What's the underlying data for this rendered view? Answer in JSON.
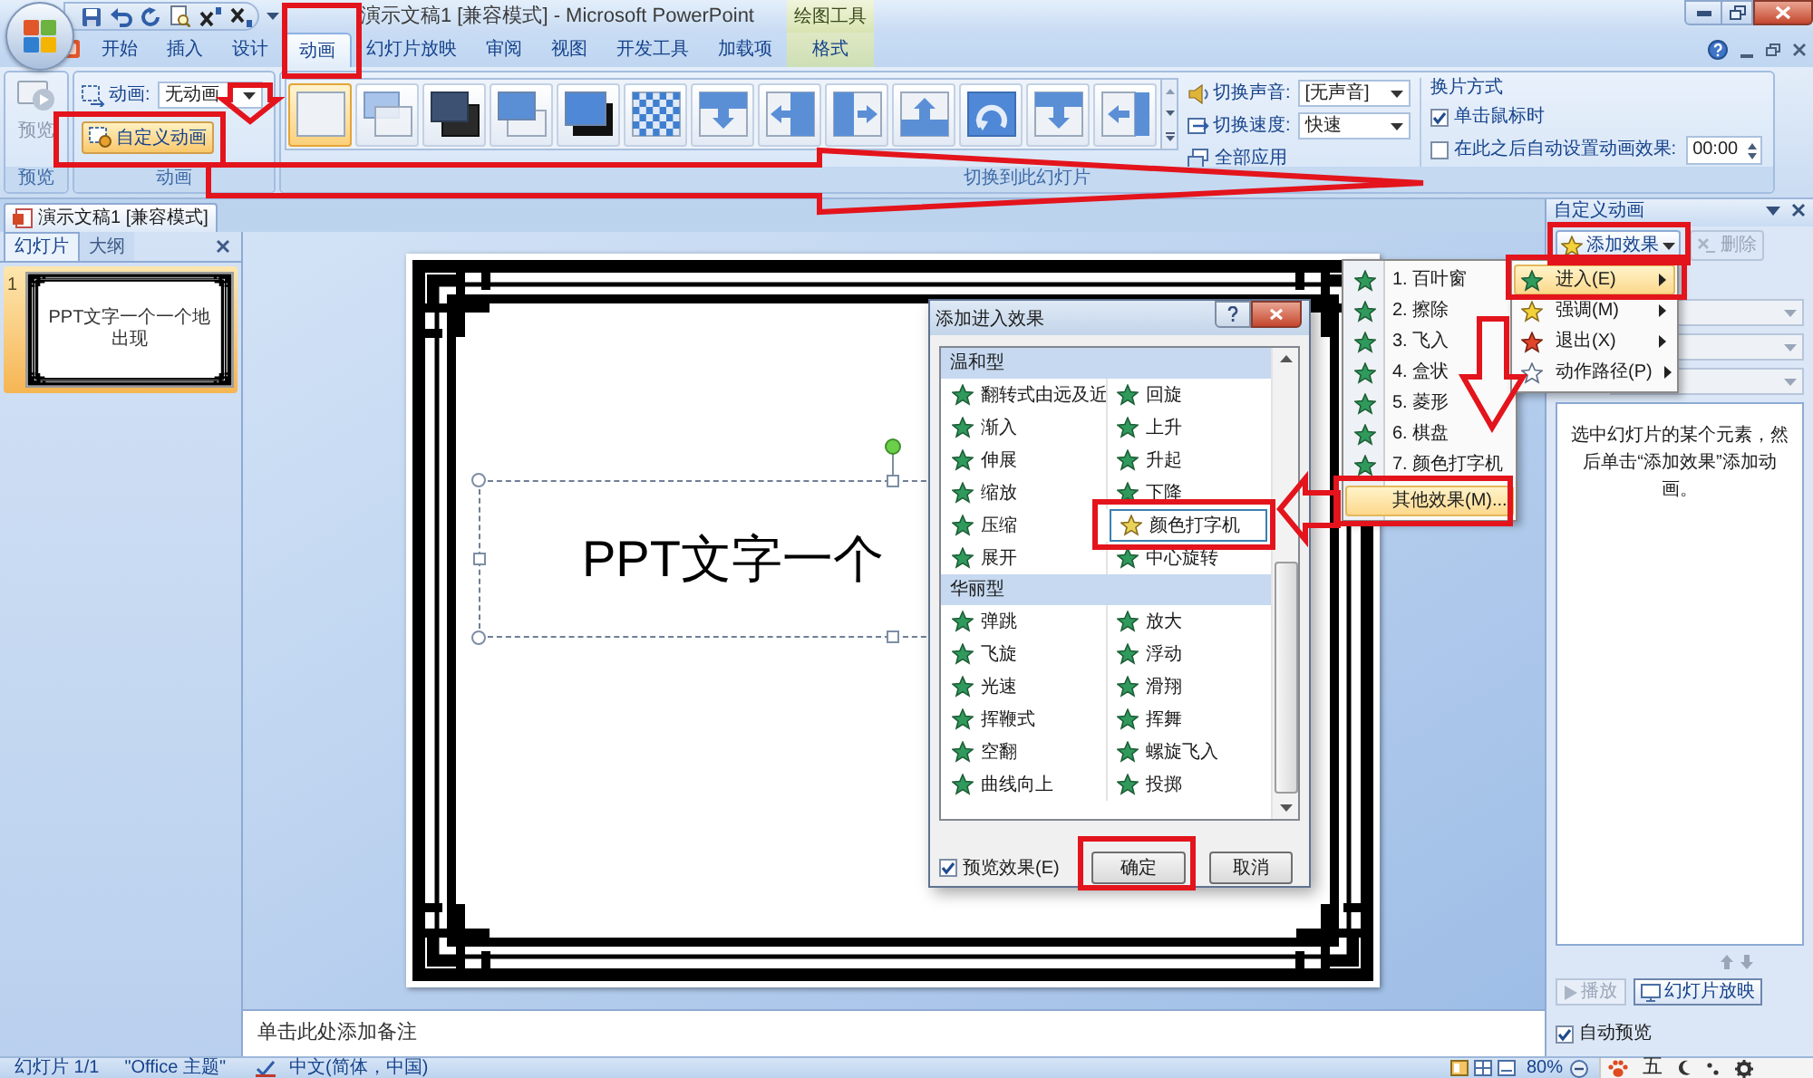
{
  "window": {
    "title": "演示文稿1 [兼容模式] - Microsoft PowerPoint",
    "context_tab_group": "绘图工具"
  },
  "ribbon_tabs": [
    {
      "label": "开始",
      "kind": "main",
      "selected": false
    },
    {
      "label": "插入",
      "kind": "main",
      "selected": false
    },
    {
      "label": "设计",
      "kind": "main",
      "selected": false
    },
    {
      "label": "动画",
      "kind": "main",
      "selected": true
    },
    {
      "label": "幻灯片放映",
      "kind": "main",
      "selected": false
    },
    {
      "label": "审阅",
      "kind": "main",
      "selected": false
    },
    {
      "label": "视图",
      "kind": "main",
      "selected": false
    },
    {
      "label": "开发工具",
      "kind": "main",
      "selected": false
    },
    {
      "label": "加载项",
      "kind": "main",
      "selected": false
    },
    {
      "label": "格式",
      "kind": "context",
      "selected": false
    }
  ],
  "ribbon": {
    "preview": {
      "button": {
        "label": "预览",
        "disabled": true
      },
      "group_label": "预览"
    },
    "animation": {
      "label": "动画:",
      "value": "无动画",
      "custom_button": {
        "label": "自定义动画",
        "selected": true
      },
      "group_label": "动画"
    },
    "transition": {
      "gallery": [
        {
          "selected": true
        },
        {
          "selected": false
        },
        {
          "selected": false
        },
        {
          "selected": false
        },
        {
          "selected": false
        },
        {
          "selected": false
        },
        {
          "selected": false
        },
        {
          "selected": false
        },
        {
          "selected": false
        },
        {
          "selected": false
        },
        {
          "selected": false
        },
        {
          "selected": false
        },
        {
          "selected": false
        }
      ],
      "sound": {
        "label": "切换声音:",
        "value": "[无声音]"
      },
      "speed": {
        "label": "切换速度:",
        "value": "快速"
      },
      "apply_all": "全部应用",
      "advance_title": "换片方式",
      "advance_options": [
        {
          "label": "单击鼠标时",
          "checked": true
        },
        {
          "label": "在此之后自动设置动画效果:",
          "checked": false,
          "value": "00:00"
        }
      ],
      "group_label": "切换到此幻灯片"
    }
  },
  "document_tab": {
    "label": "演示文稿1 [兼容模式]"
  },
  "slides_panel": {
    "tabs": [
      {
        "label": "幻灯片",
        "selected": true
      },
      {
        "label": "大纲",
        "selected": false
      }
    ],
    "slides": [
      {
        "number": "1",
        "text": "PPT文字一个一个地出现",
        "selected": true
      }
    ]
  },
  "slide": {
    "text": "PPT文字一个"
  },
  "notes": {
    "placeholder": "单击此处添加备注"
  },
  "task_pane": {
    "title": "自定义动画",
    "add_button": "添加效果",
    "remove_button": {
      "label": "删除",
      "disabled": true
    },
    "hint": "选中幻灯片的某个元素，然后单击“添加效果”添加动画。",
    "play_button": {
      "label": "播放",
      "disabled": true
    },
    "slideshow_button": "幻灯片放映",
    "auto_preview": {
      "label": "自动预览",
      "checked": true
    }
  },
  "add_effect_menu": [
    {
      "label": "进入(E)",
      "kind": "entrance",
      "selected": true
    },
    {
      "label": "强调(M)",
      "kind": "emphasis",
      "selected": false
    },
    {
      "label": "退出(X)",
      "kind": "exit",
      "selected": false
    },
    {
      "label": "动作路径(P)",
      "kind": "path",
      "selected": false
    }
  ],
  "entrance_menu": [
    {
      "label": "1. 百叶窗",
      "kind": "effect",
      "selected": false
    },
    {
      "label": "2. 擦除",
      "kind": "effect",
      "selected": false
    },
    {
      "label": "3. 飞入",
      "kind": "effect",
      "selected": false
    },
    {
      "label": "4. 盒状",
      "kind": "effect",
      "selected": false
    },
    {
      "label": "5. 菱形",
      "kind": "effect",
      "selected": false
    },
    {
      "label": "6. 棋盘",
      "kind": "effect",
      "selected": false
    },
    {
      "label": "7. 颜色打字机",
      "kind": "effect",
      "selected": false
    },
    {
      "label": "其他效果(M)...",
      "kind": "more",
      "selected": true
    }
  ],
  "dialog": {
    "title": "添加进入效果",
    "categories": [
      {
        "name": "温和型",
        "effects": [
          {
            "label": "翻转式由远及近",
            "selected": false
          },
          {
            "label": "回旋",
            "selected": false
          },
          {
            "label": "渐入",
            "selected": false
          },
          {
            "label": "上升",
            "selected": false
          },
          {
            "label": "伸展",
            "selected": false
          },
          {
            "label": "升起",
            "selected": false
          },
          {
            "label": "缩放",
            "selected": false
          },
          {
            "label": "下降",
            "selected": false
          },
          {
            "label": "压缩",
            "selected": false
          },
          {
            "label": "颜色打字机",
            "selected": true
          },
          {
            "label": "展开",
            "selected": false
          },
          {
            "label": "中心旋转",
            "selected": false
          }
        ]
      },
      {
        "name": "华丽型",
        "effects": [
          {
            "label": "弹跳",
            "selected": false
          },
          {
            "label": "放大",
            "selected": false
          },
          {
            "label": "飞旋",
            "selected": false
          },
          {
            "label": "浮动",
            "selected": false
          },
          {
            "label": "光速",
            "selected": false
          },
          {
            "label": "滑翔",
            "selected": false
          },
          {
            "label": "挥鞭式",
            "selected": false
          },
          {
            "label": "挥舞",
            "selected": false
          },
          {
            "label": "空翻",
            "selected": false
          },
          {
            "label": "螺旋飞入",
            "selected": false
          },
          {
            "label": "曲线向上",
            "selected": false
          },
          {
            "label": "投掷",
            "selected": false
          }
        ]
      }
    ],
    "preview_option": {
      "label": "预览效果(E)",
      "checked": true
    },
    "ok_button": "确定",
    "cancel_button": "取消"
  },
  "status_bar": {
    "slide": "幻灯片 1/1",
    "theme": "\"Office 主题\"",
    "language": "中文(简体，中国)",
    "zoom": "80%"
  },
  "ime_bar": {
    "mode": "五"
  }
}
